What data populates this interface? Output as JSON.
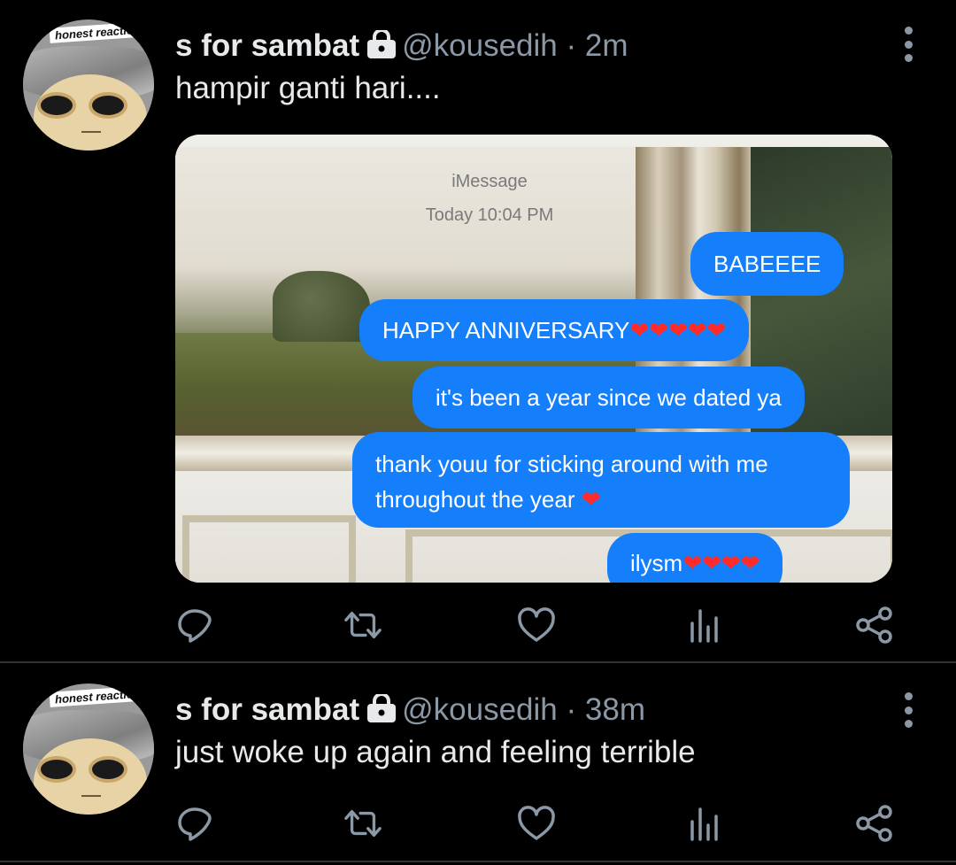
{
  "tweets": [
    {
      "avatar_label": "honest reaction",
      "name": "s for sambat",
      "handle": "@kousedih",
      "separator": "·",
      "time": "2m",
      "text": "hampir ganti hari....",
      "media": {
        "service": "iMessage",
        "date": "Today 10:04 PM",
        "messages": [
          {
            "text": "BABEEEE",
            "hearts": ""
          },
          {
            "text": "HAPPY ANNIVERSARY",
            "hearts": "❤❤❤❤❤"
          },
          {
            "text": "it's been a year since we dated ya",
            "hearts": ""
          },
          {
            "text": "thank youu for sticking around with me throughout the year",
            "hearts": "❤"
          },
          {
            "text": "ilysm",
            "hearts": "❤❤❤❤"
          }
        ]
      }
    },
    {
      "avatar_label": "honest reaction",
      "name": "s for sambat",
      "handle": "@kousedih",
      "separator": "·",
      "time": "38m",
      "text": "just woke up again and feeling terrible"
    }
  ],
  "colors": {
    "background": "#000000",
    "text": "#e7e9ea",
    "muted": "#8b98a5",
    "bubble": "#147efb",
    "heart": "#ff2a2a"
  },
  "icons": [
    "lock-icon",
    "more-icon",
    "reply-icon",
    "retweet-icon",
    "like-icon",
    "stats-icon",
    "share-icon"
  ]
}
